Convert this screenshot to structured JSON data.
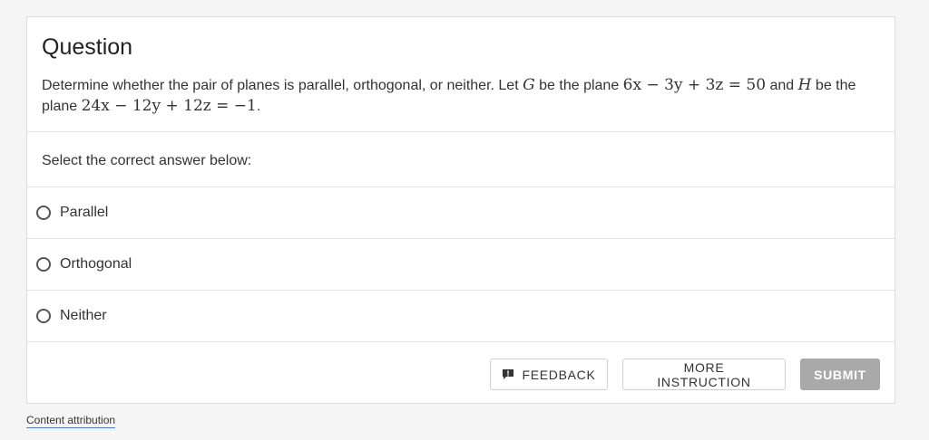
{
  "question": {
    "title": "Question",
    "text_1": "Determine whether the pair of planes is parallel, orthogonal, or neither. Let ",
    "var_g": "G",
    "text_2": " be the plane ",
    "plane_g": "6x − 3y + 3z = 50",
    "text_3": " and ",
    "var_h": "H",
    "text_4": " be the plane ",
    "plane_h": "24x − 12y + 12z = −1",
    "text_5": "."
  },
  "prompt": "Select the correct answer below:",
  "options": [
    {
      "label": "Parallel"
    },
    {
      "label": "Orthogonal"
    },
    {
      "label": "Neither"
    }
  ],
  "actions": {
    "feedback_label": "FEEDBACK",
    "more_instruction_label": "MORE INSTRUCTION",
    "submit_label": "SUBMIT"
  },
  "footer": {
    "attribution_label": "Content attribution"
  },
  "colors": {
    "submit_disabled": "#a9a9a9",
    "link_underline": "#4a7bd0"
  }
}
